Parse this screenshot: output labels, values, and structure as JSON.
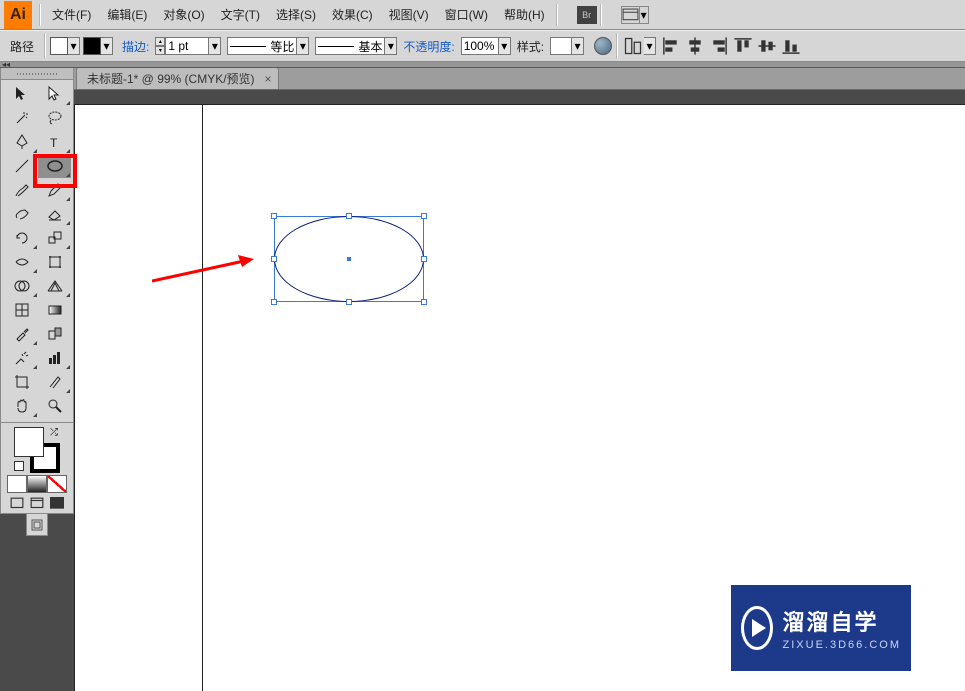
{
  "app_logo": "Ai",
  "menus": {
    "file": "文件(F)",
    "edit": "编辑(E)",
    "object": "对象(O)",
    "type": "文字(T)",
    "select": "选择(S)",
    "effect": "效果(C)",
    "view": "视图(V)",
    "window": "窗口(W)",
    "help": "帮助(H)"
  },
  "bridge_label": "Br",
  "control": {
    "selection_label": "路径",
    "stroke_label": "描边:",
    "stroke_value": "1 pt",
    "stroke_profile_suffix": "等比",
    "brush_suffix": "基本",
    "opacity_label": "不透明度:",
    "opacity_value": "100%",
    "style_label": "样式:"
  },
  "document": {
    "tab_title": "未标题-1* @ 99% (CMYK/预览)",
    "close_glyph": "×"
  },
  "watermark": {
    "title": "溜溜自学",
    "sub": "ZIXUE.3D66.COM"
  },
  "tool_names": [
    "selection-tool",
    "direct-selection-tool",
    "magic-wand-tool",
    "lasso-tool",
    "pen-tool",
    "type-tool",
    "line-segment-tool",
    "ellipse-tool",
    "paintbrush-tool",
    "pencil-tool",
    "blob-brush-tool",
    "eraser-tool",
    "rotate-tool",
    "scale-tool",
    "width-tool",
    "free-transform-tool",
    "shape-builder-tool",
    "perspective-grid-tool",
    "mesh-tool",
    "gradient-tool",
    "eyedropper-tool",
    "blend-tool",
    "symbol-sprayer-tool",
    "column-graph-tool",
    "artboard-tool",
    "slice-tool",
    "hand-tool",
    "zoom-tool"
  ]
}
